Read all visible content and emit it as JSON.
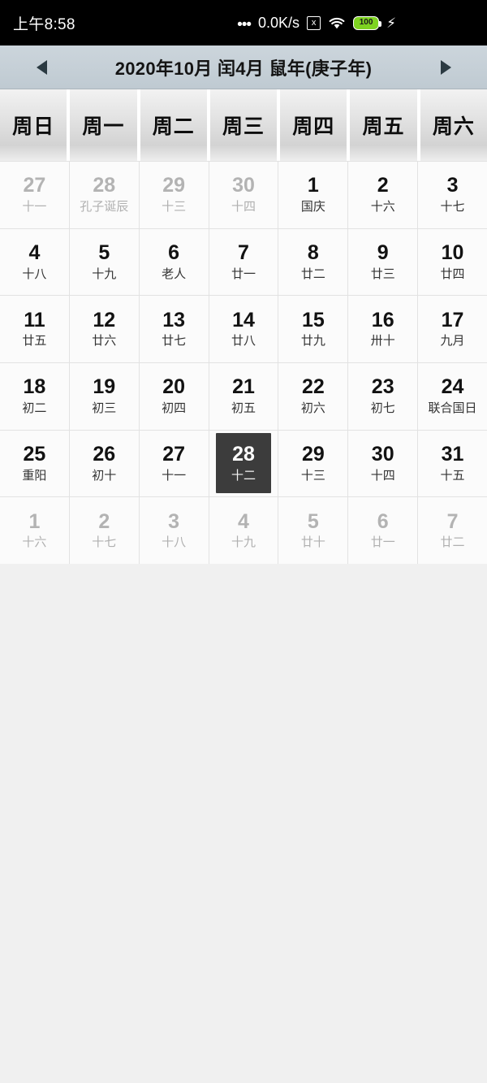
{
  "statusbar": {
    "time": "上午8:58",
    "net_dots": "•••",
    "net_speed": "0.0K/s",
    "xbox_icon_label": "x",
    "battery_level": "100",
    "bolt": "⚡"
  },
  "titlebar": {
    "prev_label": "◀",
    "next_label": "▶",
    "title": "2020年10月 闰4月 鼠年(庚子年)"
  },
  "weekdays": [
    "周日",
    "周一",
    "周二",
    "周三",
    "周四",
    "周五",
    "周六"
  ],
  "selected_date": "28",
  "colors": {
    "accent_selected": "#3c3c3c",
    "titlebar": "#c6d0d7",
    "battery_green": "#7ed321",
    "current_month_text": "#121212",
    "other_month_text": "#b3b3b3"
  },
  "days": [
    {
      "num": "27",
      "lunar": "十一",
      "month": "other",
      "selected": false
    },
    {
      "num": "28",
      "lunar": "孔子诞辰",
      "month": "other",
      "selected": false
    },
    {
      "num": "29",
      "lunar": "十三",
      "month": "other",
      "selected": false
    },
    {
      "num": "30",
      "lunar": "十四",
      "month": "other",
      "selected": false
    },
    {
      "num": "1",
      "lunar": "国庆",
      "month": "current",
      "selected": false
    },
    {
      "num": "2",
      "lunar": "十六",
      "month": "current",
      "selected": false
    },
    {
      "num": "3",
      "lunar": "十七",
      "month": "current",
      "selected": false
    },
    {
      "num": "4",
      "lunar": "十八",
      "month": "current",
      "selected": false
    },
    {
      "num": "5",
      "lunar": "十九",
      "month": "current",
      "selected": false
    },
    {
      "num": "6",
      "lunar": "老人",
      "month": "current",
      "selected": false
    },
    {
      "num": "7",
      "lunar": "廿一",
      "month": "current",
      "selected": false
    },
    {
      "num": "8",
      "lunar": "廿二",
      "month": "current",
      "selected": false
    },
    {
      "num": "9",
      "lunar": "廿三",
      "month": "current",
      "selected": false
    },
    {
      "num": "10",
      "lunar": "廿四",
      "month": "current",
      "selected": false
    },
    {
      "num": "11",
      "lunar": "廿五",
      "month": "current",
      "selected": false
    },
    {
      "num": "12",
      "lunar": "廿六",
      "month": "current",
      "selected": false
    },
    {
      "num": "13",
      "lunar": "廿七",
      "month": "current",
      "selected": false
    },
    {
      "num": "14",
      "lunar": "廿八",
      "month": "current",
      "selected": false
    },
    {
      "num": "15",
      "lunar": "廿九",
      "month": "current",
      "selected": false
    },
    {
      "num": "16",
      "lunar": "卅十",
      "month": "current",
      "selected": false
    },
    {
      "num": "17",
      "lunar": "九月",
      "month": "current",
      "selected": false
    },
    {
      "num": "18",
      "lunar": "初二",
      "month": "current",
      "selected": false
    },
    {
      "num": "19",
      "lunar": "初三",
      "month": "current",
      "selected": false
    },
    {
      "num": "20",
      "lunar": "初四",
      "month": "current",
      "selected": false
    },
    {
      "num": "21",
      "lunar": "初五",
      "month": "current",
      "selected": false
    },
    {
      "num": "22",
      "lunar": "初六",
      "month": "current",
      "selected": false
    },
    {
      "num": "23",
      "lunar": "初七",
      "month": "current",
      "selected": false
    },
    {
      "num": "24",
      "lunar": "联合国日",
      "month": "current",
      "selected": false
    },
    {
      "num": "25",
      "lunar": "重阳",
      "month": "current",
      "selected": false
    },
    {
      "num": "26",
      "lunar": "初十",
      "month": "current",
      "selected": false
    },
    {
      "num": "27",
      "lunar": "十一",
      "month": "current",
      "selected": false
    },
    {
      "num": "28",
      "lunar": "十二",
      "month": "current",
      "selected": true
    },
    {
      "num": "29",
      "lunar": "十三",
      "month": "current",
      "selected": false
    },
    {
      "num": "30",
      "lunar": "十四",
      "month": "current",
      "selected": false
    },
    {
      "num": "31",
      "lunar": "十五",
      "month": "current",
      "selected": false
    },
    {
      "num": "1",
      "lunar": "十六",
      "month": "other",
      "selected": false
    },
    {
      "num": "2",
      "lunar": "十七",
      "month": "other",
      "selected": false
    },
    {
      "num": "3",
      "lunar": "十八",
      "month": "other",
      "selected": false
    },
    {
      "num": "4",
      "lunar": "十九",
      "month": "other",
      "selected": false
    },
    {
      "num": "5",
      "lunar": "廿十",
      "month": "other",
      "selected": false
    },
    {
      "num": "6",
      "lunar": "廿一",
      "month": "other",
      "selected": false
    },
    {
      "num": "7",
      "lunar": "廿二",
      "month": "other",
      "selected": false
    }
  ]
}
